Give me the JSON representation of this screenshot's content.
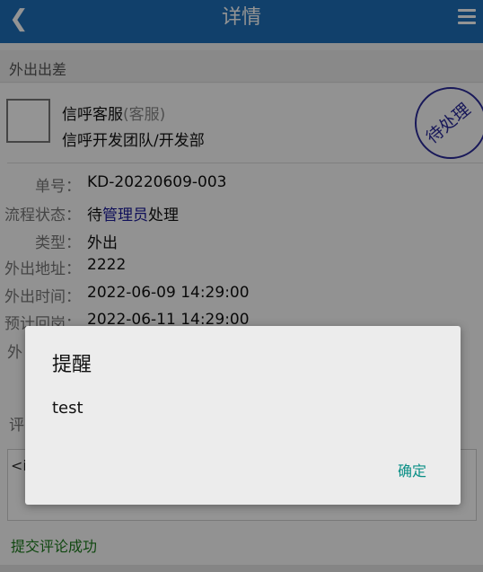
{
  "header": {
    "back_icon": "chevron-left-icon",
    "title": "详情",
    "menu_icon": "hamburger-menu-icon"
  },
  "section": {
    "title": "外出出差"
  },
  "applicant": {
    "name": "信呼客服",
    "role": "(客服)",
    "team": "信呼开发团队/开发部",
    "stamp": "待处理"
  },
  "fields": [
    {
      "label": "单号：",
      "value": "KD-20220609-003"
    },
    {
      "label": "流程状态：",
      "value_prefix": "待",
      "value_link": "管理员",
      "value_suffix": "处理"
    },
    {
      "label": "类型：",
      "value": "外出"
    },
    {
      "label": "外出地址：",
      "value": "2222"
    },
    {
      "label": "外出时间：",
      "value": "2022-06-09 14:29:00"
    },
    {
      "label": "预计回岗：",
      "value": "2022-06-11 14:29:00"
    },
    {
      "label": "外",
      "value": ""
    }
  ],
  "comment": {
    "label": "评",
    "input_partial": "<ir"
  },
  "status": {
    "success_text": "提交评论成功"
  },
  "dialog": {
    "title": "提醒",
    "message": "test",
    "ok_label": "确定"
  },
  "colors": {
    "header_bg": "#1e6fb8",
    "link": "#1a1a99",
    "stamp": "#2a2a9a",
    "ok_button": "#0a8f86",
    "success": "#1a7a1a"
  }
}
